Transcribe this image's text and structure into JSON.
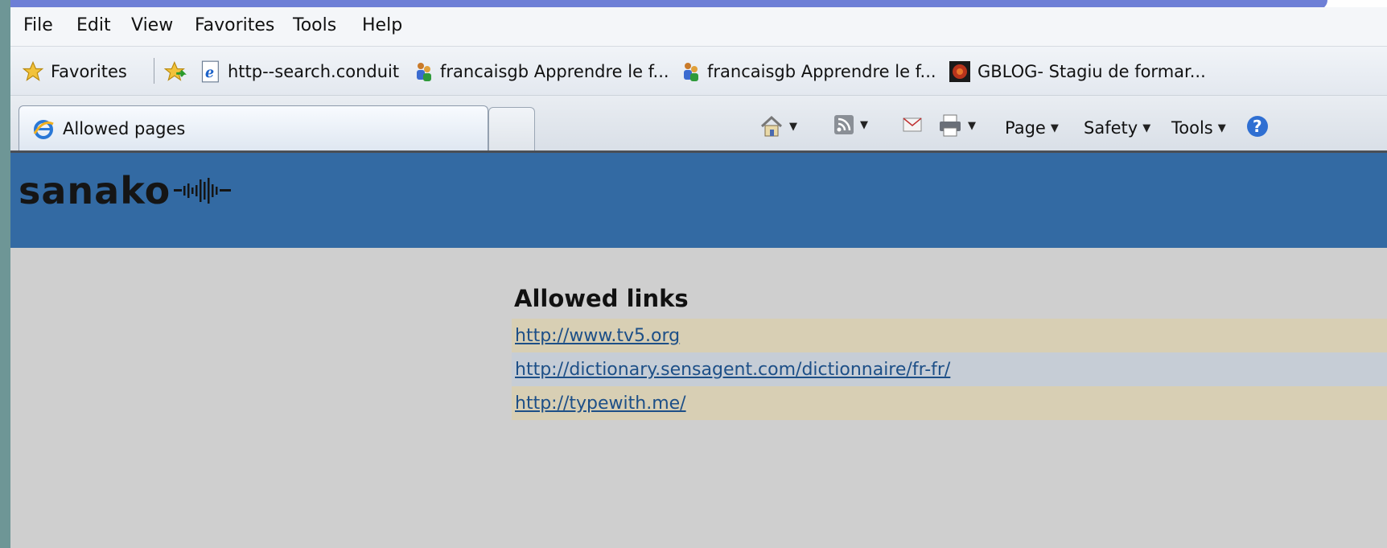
{
  "menu": [
    "File",
    "Edit",
    "View",
    "Favorites",
    "Tools",
    "Help"
  ],
  "favorites_bar": {
    "favorites_label": "Favorites",
    "items": [
      "http--search.conduit",
      "francaisgb  Apprendre le f...",
      "francaisgb  Apprendre le f...",
      "GBLOG- Stagiu de formar..."
    ]
  },
  "tab": {
    "title": "Allowed pages"
  },
  "command_bar": {
    "page": "Page",
    "safety": "Safety",
    "tools": "Tools"
  },
  "header": {
    "logo_text": "sanako"
  },
  "content": {
    "title": "Allowed links",
    "links": [
      "http://www.tv5.org",
      "http://dictionary.sensagent.com/dictionnaire/fr-fr/",
      "http://typewith.me/"
    ]
  },
  "colors": {
    "header_bg": "#336aa3",
    "row_a": "#d8cfb4",
    "row_b": "#c6cdd6",
    "link": "#1d4f87"
  }
}
